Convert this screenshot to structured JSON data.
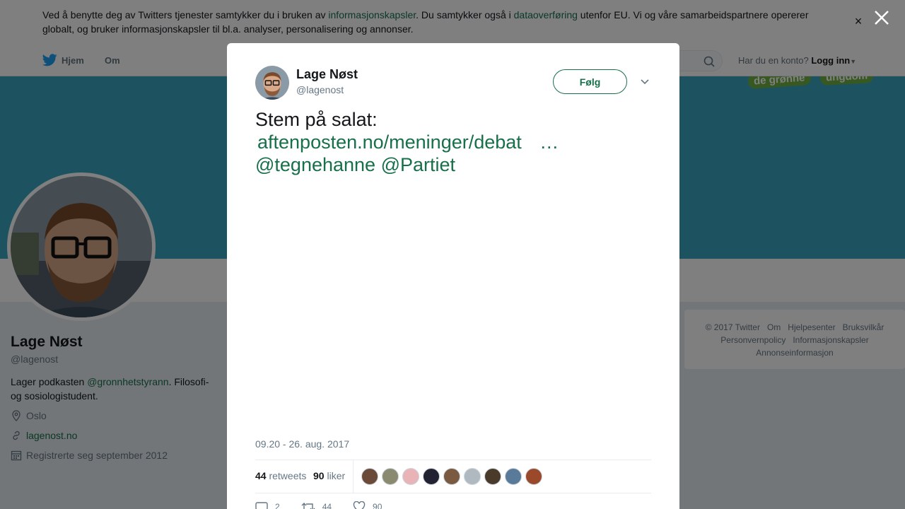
{
  "cookie": {
    "text_a": "Ved å benytte deg av Twitters tjenester samtykker du i bruken av ",
    "link_a": "informasjonskapsler",
    "text_b": ". Du samtykker også i ",
    "link_b": "dataoverføring",
    "text_c": " utenfor EU. Vi og våre samarbeidspartnere opererer globalt, og bruker informasjonskapsler til bl.a. analyser, personalisering og annonser.",
    "close": "×"
  },
  "nav": {
    "home": "Hjem",
    "about": "Om",
    "login_prompt": "Har du en konto?",
    "login": "Logg inn"
  },
  "banner": {
    "logo_left": "de grønne",
    "logo_right": "ungdom"
  },
  "profile": {
    "name": "Lage Nøst",
    "handle": "@lagenost",
    "bio_a": "Lager podkasten ",
    "bio_link": "@gronnhetstyrann",
    "bio_b": ". Filosofi- og sosiologistudent.",
    "location": "Oslo",
    "website": "lagenost.no",
    "joined": "Registrerte seg september 2012"
  },
  "footer": {
    "items": [
      "© 2017 Twitter",
      "Om",
      "Hjelpesenter",
      "Bruksvilkår",
      "Personvernpolicy",
      "Informasjonskapsler",
      "Annonseinformasjon"
    ]
  },
  "tweet": {
    "name": "Lage Nøst",
    "handle": "@lagenost",
    "follow": "Følg",
    "text_line1": "Stem på salat:",
    "link": "aftenposten.no/meninger/debat",
    "ellipsis": " …",
    "mention1": "@tegnehanne",
    "mention2": "@Partiet",
    "date": "09.20 - 26. aug. 2017",
    "retweets_count": "44",
    "retweets_label": "retweets",
    "likes_count": "90",
    "likes_label": "liker",
    "reply_count": "2",
    "retweet_action_count": "44",
    "like_action_count": "90"
  },
  "colors": {
    "brand_green": "#17704a",
    "banner_teal": "#3ba7c0",
    "twitter_blue": "#1da1f2"
  },
  "likers": [
    "#6b4a3a",
    "#8a8a70",
    "#e8b4b8",
    "#222233",
    "#7a5a40",
    "#b0b8c0",
    "#4a3a2a",
    "#5a7a9a",
    "#9a4a2a"
  ]
}
